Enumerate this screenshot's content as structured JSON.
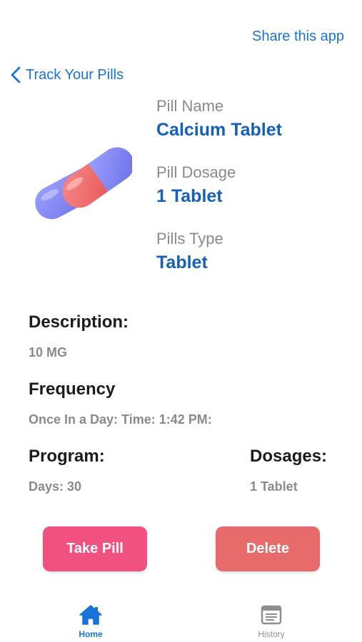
{
  "header": {
    "share_label": "Share this app",
    "back_label": "Track Your Pills"
  },
  "pill": {
    "name_label": "Pill Name",
    "name_value": "Calcium Tablet",
    "dosage_label": "Pill Dosage",
    "dosage_value": "1 Tablet",
    "type_label": "Pills Type",
    "type_value": "Tablet"
  },
  "details": {
    "description_title": "Description:",
    "description_value": "10 MG",
    "frequency_title": "Frequency",
    "frequency_value": "Once In a Day: Time:  1:42 PM:",
    "program_title": "Program:",
    "program_value": "Days: 30",
    "dosages_title": "Dosages:",
    "dosages_value": "1 Tablet"
  },
  "actions": {
    "take_label": "Take Pill",
    "delete_label": "Delete"
  },
  "tabs": [
    {
      "label": "Home",
      "icon": "home-icon",
      "active": true
    },
    {
      "label": "History",
      "icon": "history-icon",
      "active": false
    }
  ],
  "colors": {
    "accent": "#1a73d9",
    "value_blue": "#1560b8",
    "take_button": "#f0517e",
    "delete_button": "#e86b6b",
    "pill_red": "#ef6b6b",
    "pill_blue": "#7b7ff0"
  }
}
